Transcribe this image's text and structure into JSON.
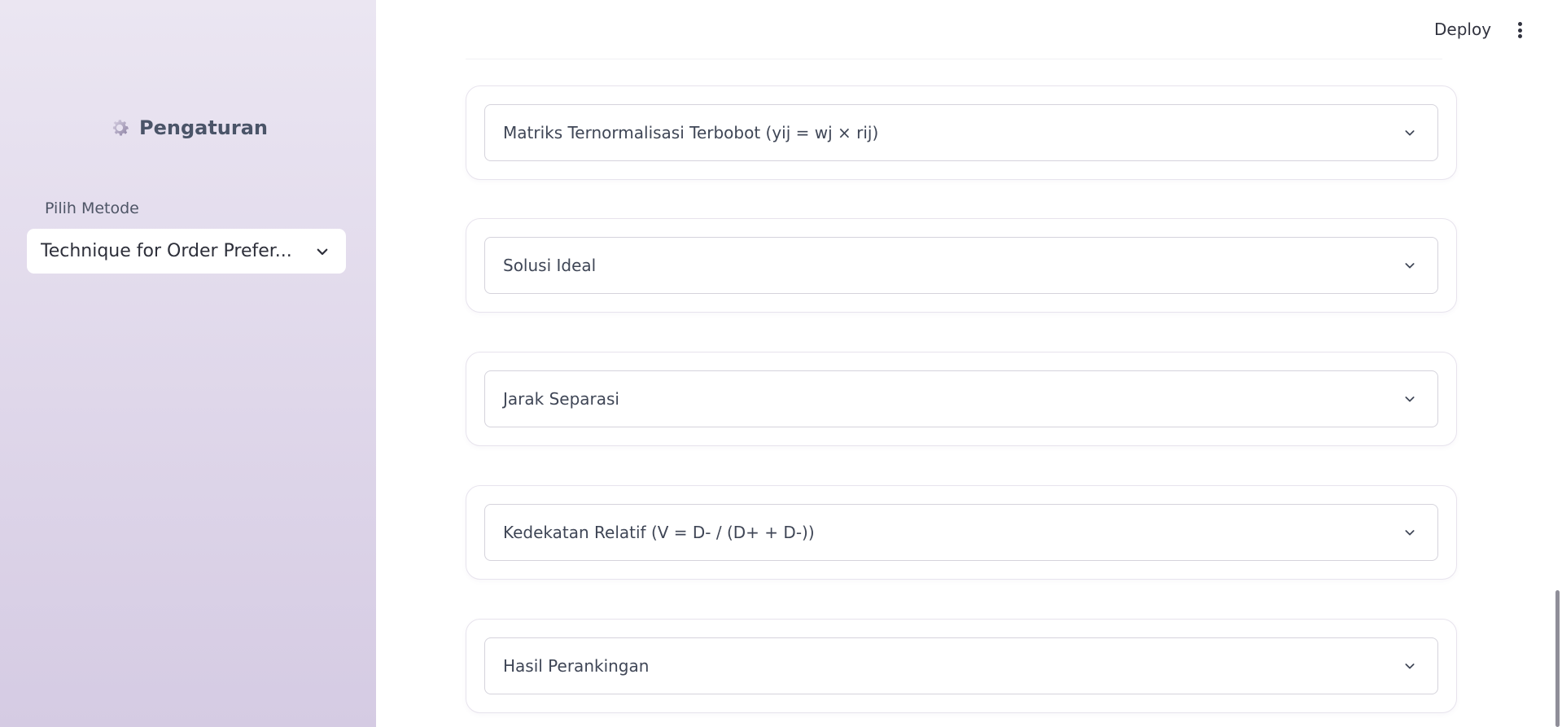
{
  "sidebar": {
    "title": "Pengaturan",
    "title_icon": "gear-icon",
    "select_label": "Pilih Metode",
    "select_value": "Technique for Order Prefer..."
  },
  "topbar": {
    "deploy_label": "Deploy",
    "menu_icon": "kebab-menu-icon"
  },
  "sections": [
    {
      "label": "Matriks Ternormalisasi Terbobot (yij = wj × rij)"
    },
    {
      "label": "Solusi Ideal"
    },
    {
      "label": "Jarak Separasi"
    },
    {
      "label": "Kedekatan Relatif (V = D- / (D+ + D-))"
    },
    {
      "label": "Hasil Perankingan"
    }
  ],
  "colors": {
    "sidebar_top": "#ebe6f2",
    "sidebar_bottom": "#d5cbe3",
    "text_dark": "#31333f",
    "card_border": "#e7e3ed"
  }
}
